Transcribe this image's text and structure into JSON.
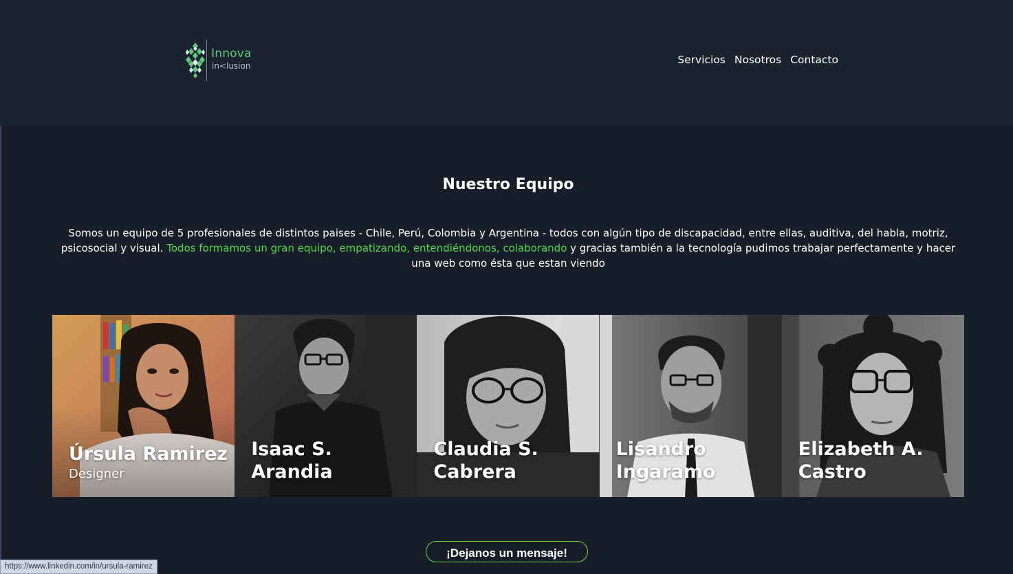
{
  "header": {
    "logo": {
      "line1": "Innova",
      "line2": "in<lusion"
    },
    "nav": [
      {
        "label": "Servicios"
      },
      {
        "label": "Nosotros"
      },
      {
        "label": "Contacto"
      }
    ]
  },
  "team_section": {
    "title": "Nuestro Equipo",
    "intro_part1": "Somos un equipo de 5 profesionales de distintos paises - Chile, Perú, Colombia y Argentina - todos con algún tipo de discapacidad, entre ellas, auditiva, del habla, motriz, psicosocial y visual. ",
    "intro_highlight": "Todos formamos un gran equipo, empatizando, entendiéndonos, colaborando",
    "intro_part2": " y gracias también a la tecnología pudimos trabajar perfectamente y hacer una web como ésta que estan viendo",
    "members": [
      {
        "name": "Úrsula Ramirez",
        "role": "Designer"
      },
      {
        "name": "Isaac S. Arandia",
        "role": ""
      },
      {
        "name": "Claudia S. Cabrera",
        "role": ""
      },
      {
        "name": "Lisandro Ingaramo",
        "role": ""
      },
      {
        "name": "Elizabeth A. Castro",
        "role": ""
      }
    ]
  },
  "cta": {
    "label": "¡Dejanos un mensaje!"
  },
  "status_bar": {
    "url": "https://www.linkedin.com/in/ursula-ramirez"
  },
  "colors": {
    "background": "#171e29",
    "header_background": "#1b2331",
    "accent_green": "#4ddb4a",
    "logo_green": "#5ec77e"
  }
}
